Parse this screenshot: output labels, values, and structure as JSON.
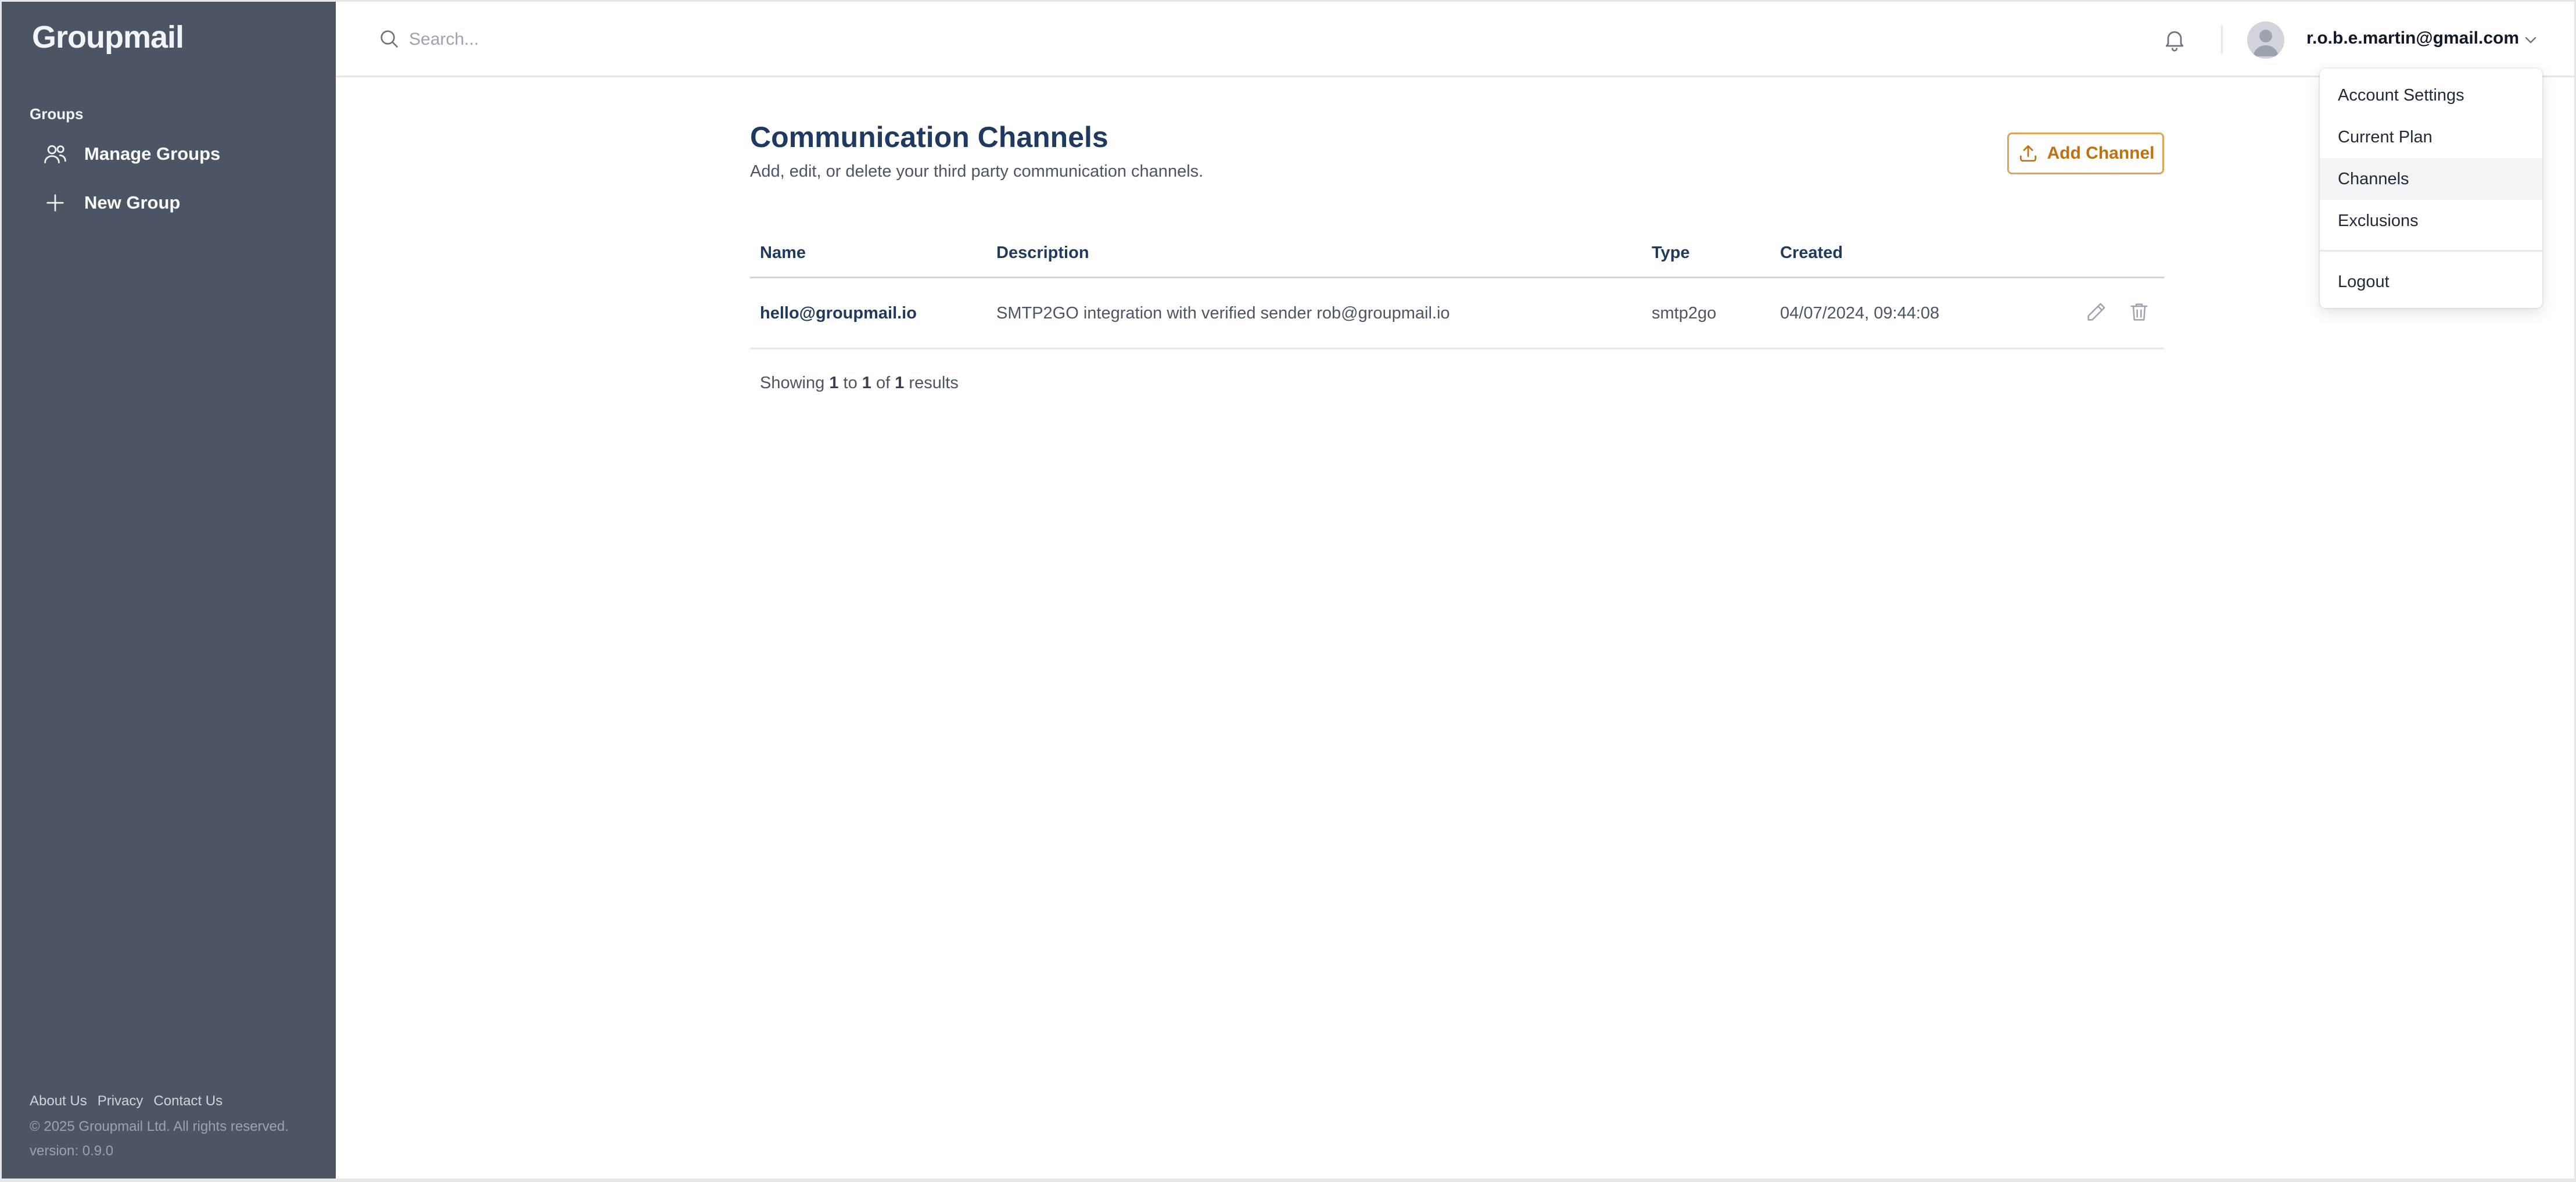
{
  "app": {
    "logo": "Groupmail"
  },
  "sidebar": {
    "section_label": "Groups",
    "items": [
      {
        "label": "Manage Groups",
        "icon": "users-icon"
      },
      {
        "label": "New Group",
        "icon": "plus-icon"
      }
    ],
    "footer": {
      "links": [
        "About Us",
        "Privacy",
        "Contact Us"
      ],
      "copyright": "© 2025 Groupmail Ltd. All rights reserved.",
      "version": "version: 0.9.0"
    }
  },
  "header": {
    "search": {
      "placeholder": "Search...",
      "value": ""
    },
    "user_email": "r.o.b.e.martin@gmail.com"
  },
  "dropdown": {
    "items": [
      "Account Settings",
      "Current Plan",
      "Channels",
      "Exclusions"
    ],
    "active": "Channels",
    "logout": "Logout"
  },
  "page": {
    "title": "Communication Channels",
    "subtitle": "Add, edit, or delete your third party communication channels.",
    "add_button": "Add Channel"
  },
  "table": {
    "columns": [
      "Name",
      "Description",
      "Type",
      "Created"
    ],
    "rows": [
      {
        "name": "hello@groupmail.io",
        "description": "SMTP2GO integration with verified sender rob@groupmail.io",
        "type": "smtp2go",
        "created": "04/07/2024, 09:44:08"
      }
    ],
    "results": {
      "prefix": "Showing",
      "from": "1",
      "to_word": "to",
      "to": "1",
      "of_word": "of",
      "total": "1",
      "suffix": "results"
    }
  },
  "colors": {
    "sidebar_bg": "#4b5563",
    "heading": "#1e3a5f",
    "accent": "#c2700f",
    "accent_border": "#e0a35a"
  }
}
